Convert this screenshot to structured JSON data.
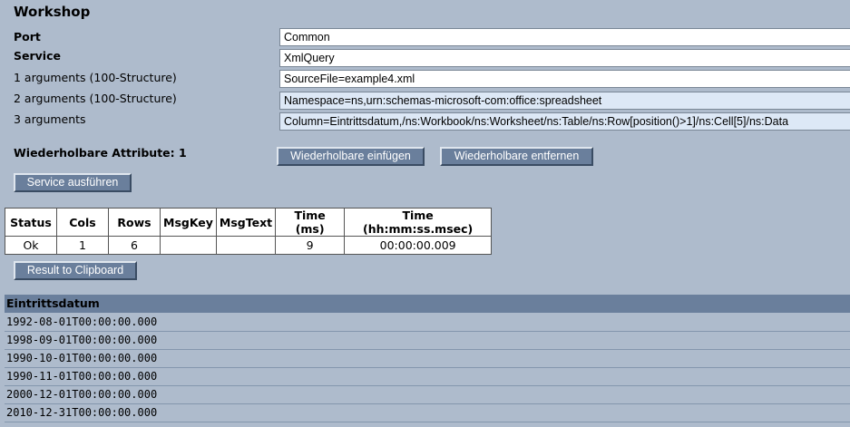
{
  "title": "Workshop",
  "form": {
    "port_label": "Port",
    "port_value": "Common",
    "service_label": "Service",
    "service_value": "XmlQuery",
    "arg1_label": "1 arguments (100-Structure)",
    "arg1_value": "SourceFile=example4.xml",
    "arg2_label": "2 arguments (100-Structure)",
    "arg2_value": "Namespace=ns,urn:schemas-microsoft-com:office:spreadsheet",
    "arg3_label": "3 arguments",
    "arg3_value": "Column=Eintrittsdatum,/ns:Workbook/ns:Worksheet/ns:Table/ns:Row[position()>1]/ns:Cell[5]/ns:Data"
  },
  "repeatable": {
    "label": "Wiederholbare Attribute: 1",
    "insert_label": "Wiederholbare einfügen",
    "remove_label": "Wiederholbare entfernen"
  },
  "run_button": "Service ausführen",
  "stats": {
    "headers": [
      "Status",
      "Cols",
      "Rows",
      "MsgKey",
      "MsgText",
      "Time (ms)",
      "Time (hh:mm:ss.msec)"
    ],
    "row": [
      "Ok",
      "1",
      "6",
      "",
      "",
      "9",
      "00:00:00.009"
    ]
  },
  "clipboard_button": "Result to Clipboard",
  "result": {
    "column": "Eintrittsdatum",
    "rows": [
      "1992-08-01T00:00:00.000",
      "1998-09-01T00:00:00.000",
      "1990-10-01T00:00:00.000",
      "1990-11-01T00:00:00.000",
      "2000-12-01T00:00:00.000",
      "2010-12-31T00:00:00.000"
    ]
  },
  "colors": {
    "background": "#aebbcc",
    "button": "#6a7f9c",
    "field_highlight": "#dde8f6"
  }
}
